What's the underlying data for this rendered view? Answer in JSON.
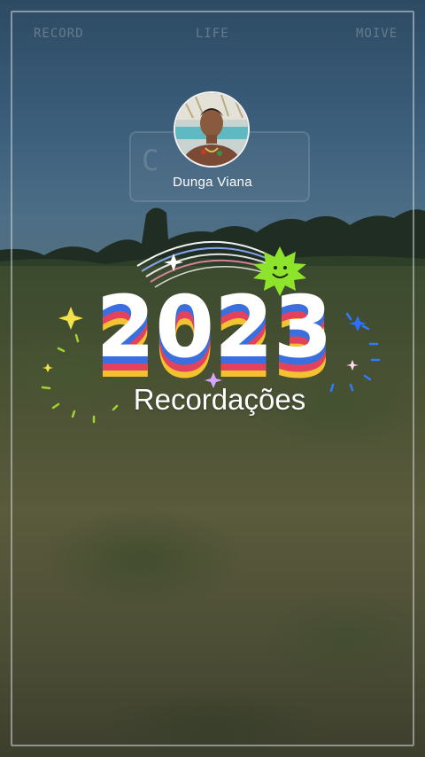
{
  "overlay_words": {
    "left": "RECORD",
    "center": "LIFE",
    "right": "MOIVE"
  },
  "ghost_letter": "C",
  "profile": {
    "name": "Dunga  Viana",
    "avatar": "profile-photo"
  },
  "badge": {
    "year": "2023",
    "subtitle": "Recordações"
  },
  "colors": {
    "stripe_blue": "#3a6fe0",
    "stripe_red": "#e2425b",
    "stripe_yellow": "#f2c230",
    "sun_green": "#8ee42a"
  }
}
